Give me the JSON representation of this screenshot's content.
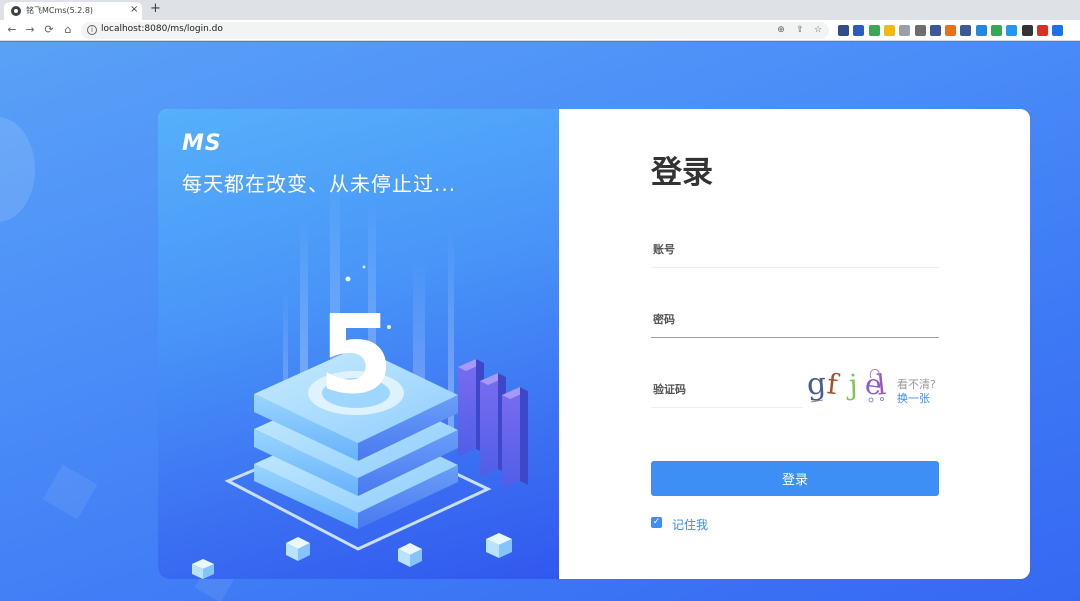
{
  "browser": {
    "tab_title": "铭飞MCms(5.2.8)",
    "tab_close": "×",
    "new_tab": "+",
    "url": "localhost:8080/ms/login.do",
    "nav": {
      "back": "←",
      "forward": "→",
      "reload": "⟳",
      "home": "⌂"
    },
    "omnibox_icons": {
      "zoom": "⊕",
      "share": "⇪",
      "bookmark": "☆"
    },
    "extensions": [
      {
        "name": "ext-1-icon",
        "color": "#2f4d8a"
      },
      {
        "name": "ext-2-icon",
        "color": "#2c5bbf"
      },
      {
        "name": "ext-3-icon",
        "color": "#3aa757"
      },
      {
        "name": "ext-4-icon",
        "color": "#f2b90f"
      },
      {
        "name": "ext-5-icon",
        "color": "#9aa0a6"
      },
      {
        "name": "ext-6-icon",
        "color": "#6d6d6d"
      },
      {
        "name": "ext-7-icon",
        "color": "#3b5998"
      },
      {
        "name": "ext-8-icon",
        "color": "#e8711a"
      },
      {
        "name": "ext-9-icon",
        "color": "#3b5998"
      },
      {
        "name": "ext-10-icon",
        "color": "#1e88e5"
      },
      {
        "name": "ext-11-icon",
        "color": "#34a853"
      },
      {
        "name": "ext-12-icon",
        "color": "#2196f3"
      },
      {
        "name": "ext-13-icon",
        "color": "#333333"
      },
      {
        "name": "ext-14-icon",
        "color": "#d93025"
      },
      {
        "name": "ext-15-icon",
        "color": "#1a73e8"
      }
    ]
  },
  "promo": {
    "logo": "MS",
    "slogan": "每天都在改变、从未停止过...",
    "hero_number": "5"
  },
  "login": {
    "title": "登录",
    "username_label": "账号",
    "password_label": "密码",
    "captcha_label": "验证码",
    "captcha_text": "gfjel",
    "captcha_hint": "看不清?",
    "captcha_refresh": "换一张",
    "submit_label": "登录",
    "remember_label": "记住我",
    "remember_checked": true
  },
  "colors": {
    "accent": "#3d8ff5",
    "link": "#3a8cf0",
    "underline_inactive": "#eeeeee",
    "underline_active": "#9e9e9e"
  }
}
